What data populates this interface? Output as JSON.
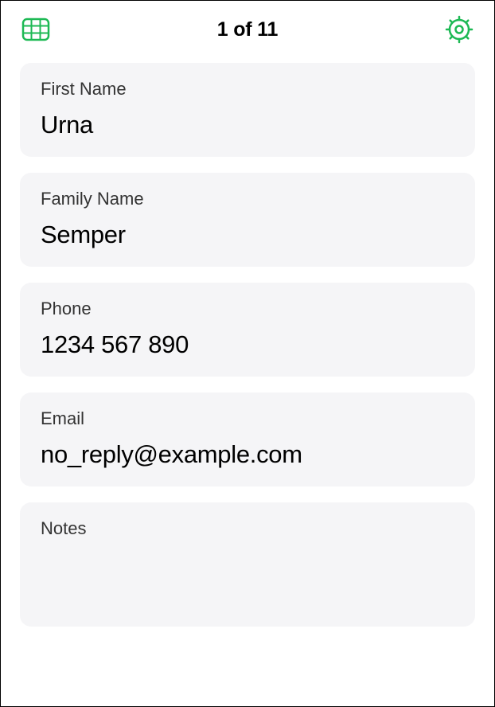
{
  "header": {
    "title": "1 of 11"
  },
  "fields": {
    "firstName": {
      "label": "First Name",
      "value": "Urna"
    },
    "familyName": {
      "label": "Family Name",
      "value": "Semper"
    },
    "phone": {
      "label": "Phone",
      "value": "1234 567 890"
    },
    "email": {
      "label": "Email",
      "value": "no_reply@example.com"
    },
    "notes": {
      "label": "Notes",
      "value": ""
    }
  },
  "colors": {
    "accent": "#1DB954"
  }
}
